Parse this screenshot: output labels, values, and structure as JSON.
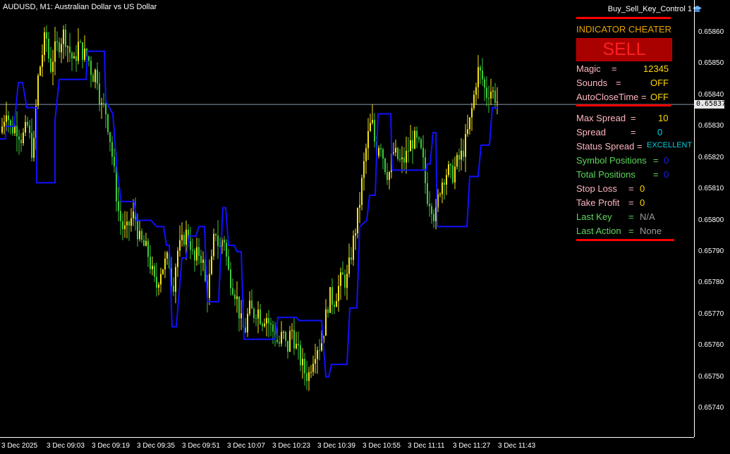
{
  "window": {
    "title": "AUDUSD, M1:  Australian Dollar vs US Dollar",
    "ea_name": "Buy_Sell_Key_Control 1",
    "current_price": "0.65837"
  },
  "axes": {
    "price_labels": [
      "0.65860",
      "0.65850",
      "0.65840",
      "0.65830",
      "0.65820",
      "0.65810",
      "0.65800",
      "0.65790",
      "0.65780",
      "0.65770",
      "0.65760",
      "0.65750",
      "0.65740"
    ],
    "time_labels": [
      "3 Dec 2025",
      "3 Dec 09:03",
      "3 Dec 09:19",
      "3 Dec 09:35",
      "3 Dec 09:51",
      "3 Dec 10:07",
      "3 Dec 10:23",
      "3 Dec 10:39",
      "3 Dec 10:55",
      "3 Dec 11:11",
      "3 Dec 11:27",
      "3 Dec 11:43"
    ]
  },
  "panel": {
    "title": "INDICATOR CHEATER",
    "signal": "SELL",
    "magic_label": "Magic",
    "magic_eq": "=",
    "magic_value": "12345",
    "sounds_label": "Sounds",
    "sounds_eq": "=",
    "sounds_value": "OFF",
    "autoclose_label": "AutoCloseTime =",
    "autoclose_value": "OFF",
    "max_spread_label": "Max Spread",
    "max_spread_eq": "=",
    "max_spread_value": "10",
    "spread_label": "Spread",
    "spread_eq": "=",
    "spread_value": "0",
    "status_spread_label": "Status Spread =",
    "status_spread_value": "EXCELLENT",
    "symbol_positions_label": "Symbol Positions",
    "symbol_positions_eq": "=",
    "symbol_positions_value": "0",
    "total_positions_label": "Total Positions",
    "total_positions_eq": "=",
    "total_positions_value": "0",
    "stop_loss_label": "Stop Loss",
    "stop_loss_eq": "=",
    "stop_loss_value": "0",
    "take_profit_label": "Take Profit",
    "take_profit_eq": "=",
    "take_profit_value": "0",
    "last_key_label": "Last Key",
    "last_key_eq": "=",
    "last_key_value": "N/A",
    "last_action_label": "Last Action",
    "last_action_eq": "=",
    "last_action_value": "None"
  },
  "colors": {
    "bull": "#f2e11a",
    "bear": "#3cc93c",
    "indicator": "#1010ff",
    "bid_line": "#8a9ab0",
    "title": "#e8a300",
    "label_pink": "#ffb6c1",
    "label_green": "#5cd65c",
    "value_yellow": "#ffd700",
    "value_cyan": "#00d0e0",
    "value_blue": "#1c1cff",
    "value_gray": "#9a9a9a"
  },
  "chart_data": {
    "type": "candlestick",
    "symbol": "AUDUSD",
    "timeframe": "M1",
    "ylim": [
      0.65734,
      0.65868
    ],
    "y_ticks": [
      0.6586,
      0.6585,
      0.6584,
      0.6583,
      0.6582,
      0.6581,
      0.658,
      0.6579,
      0.6578,
      0.6577,
      0.6576,
      0.6575,
      0.6574
    ],
    "bid": 0.65837,
    "x_ticks": [
      "3 Dec 2025",
      "3 Dec 09:03",
      "3 Dec 09:19",
      "3 Dec 09:35",
      "3 Dec 09:51",
      "3 Dec 10:07",
      "3 Dec 10:23",
      "3 Dec 10:39",
      "3 Dec 10:55",
      "3 Dec 11:11",
      "3 Dec 11:27",
      "3 Dec 11:43"
    ],
    "close_path": [
      [
        0,
        0.65828
      ],
      [
        8,
        0.65836
      ],
      [
        14,
        0.65829
      ],
      [
        22,
        0.6583
      ],
      [
        30,
        0.65826
      ],
      [
        38,
        0.6583
      ],
      [
        46,
        0.6582
      ],
      [
        52,
        0.65844
      ],
      [
        58,
        0.65852
      ],
      [
        64,
        0.6586
      ],
      [
        70,
        0.65848
      ],
      [
        76,
        0.65854
      ],
      [
        82,
        0.65856
      ],
      [
        90,
        0.6586
      ],
      [
        96,
        0.65855
      ],
      [
        104,
        0.6585
      ],
      [
        110,
        0.65856
      ],
      [
        118,
        0.65853
      ],
      [
        124,
        0.65852
      ],
      [
        130,
        0.65846
      ],
      [
        136,
        0.65848
      ],
      [
        142,
        0.65836
      ],
      [
        148,
        0.65836
      ],
      [
        154,
        0.65828
      ],
      [
        160,
        0.65817
      ],
      [
        166,
        0.65804
      ],
      [
        172,
        0.65798
      ],
      [
        178,
        0.65796
      ],
      [
        184,
        0.658
      ],
      [
        190,
        0.65802
      ],
      [
        196,
        0.65794
      ],
      [
        202,
        0.65792
      ],
      [
        208,
        0.6579
      ],
      [
        214,
        0.65784
      ],
      [
        220,
        0.65778
      ],
      [
        226,
        0.65784
      ],
      [
        232,
        0.65786
      ],
      [
        238,
        0.65788
      ],
      [
        244,
        0.65778
      ],
      [
        250,
        0.6579
      ],
      [
        256,
        0.65792
      ],
      [
        262,
        0.65796
      ],
      [
        268,
        0.65794
      ],
      [
        274,
        0.65786
      ],
      [
        280,
        0.6579
      ],
      [
        286,
        0.65788
      ],
      [
        292,
        0.65776
      ],
      [
        298,
        0.65784
      ],
      [
        304,
        0.65798
      ],
      [
        310,
        0.6579
      ],
      [
        316,
        0.65796
      ],
      [
        322,
        0.65784
      ],
      [
        328,
        0.6578
      ],
      [
        334,
        0.65776
      ],
      [
        340,
        0.65768
      ],
      [
        346,
        0.65764
      ],
      [
        352,
        0.65772
      ],
      [
        358,
        0.6577
      ],
      [
        364,
        0.65772
      ],
      [
        370,
        0.65768
      ],
      [
        376,
        0.6577
      ],
      [
        382,
        0.65766
      ],
      [
        388,
        0.65764
      ],
      [
        394,
        0.6576
      ],
      [
        400,
        0.65764
      ],
      [
        406,
        0.65758
      ],
      [
        412,
        0.65766
      ],
      [
        418,
        0.6576
      ],
      [
        424,
        0.65756
      ],
      [
        430,
        0.65752
      ],
      [
        436,
        0.6575
      ],
      [
        442,
        0.65756
      ],
      [
        448,
        0.6576
      ],
      [
        454,
        0.6576
      ],
      [
        460,
        0.65768
      ],
      [
        466,
        0.65776
      ],
      [
        472,
        0.65774
      ],
      [
        478,
        0.65778
      ],
      [
        484,
        0.65782
      ],
      [
        490,
        0.6578
      ],
      [
        496,
        0.65788
      ],
      [
        502,
        0.65796
      ],
      [
        508,
        0.65804
      ],
      [
        514,
        0.65816
      ],
      [
        520,
        0.65826
      ],
      [
        526,
        0.65832
      ],
      [
        532,
        0.65822
      ],
      [
        538,
        0.65826
      ],
      [
        544,
        0.65818
      ],
      [
        550,
        0.65814
      ],
      [
        556,
        0.65822
      ],
      [
        562,
        0.6582
      ],
      [
        568,
        0.65818
      ],
      [
        574,
        0.6582
      ],
      [
        580,
        0.65824
      ],
      [
        586,
        0.65826
      ],
      [
        592,
        0.65824
      ],
      [
        598,
        0.6582
      ],
      [
        604,
        0.65808
      ],
      [
        610,
        0.65806
      ],
      [
        616,
        0.658
      ],
      [
        622,
        0.6581
      ],
      [
        628,
        0.65814
      ],
      [
        634,
        0.65816
      ],
      [
        640,
        0.65814
      ],
      [
        646,
        0.65818
      ],
      [
        652,
        0.6582
      ],
      [
        658,
        0.65824
      ],
      [
        664,
        0.6583
      ],
      [
        670,
        0.65838
      ],
      [
        676,
        0.65848
      ],
      [
        682,
        0.65846
      ],
      [
        688,
        0.6584
      ],
      [
        694,
        0.65842
      ],
      [
        700,
        0.6584
      ],
      [
        706,
        0.65837
      ]
    ],
    "indicator_line": [
      [
        0,
        0.65826
      ],
      [
        8,
        0.65826
      ],
      [
        8,
        0.6583
      ],
      [
        20,
        0.6583
      ],
      [
        26,
        0.65844
      ],
      [
        32,
        0.65844
      ],
      [
        38,
        0.65836
      ],
      [
        52,
        0.65836
      ],
      [
        52,
        0.65812
      ],
      [
        78,
        0.65812
      ],
      [
        78,
        0.65832
      ],
      [
        84,
        0.65845
      ],
      [
        122,
        0.65845
      ],
      [
        124,
        0.65854
      ],
      [
        148,
        0.65854
      ],
      [
        150,
        0.65838
      ],
      [
        160,
        0.65834
      ],
      [
        166,
        0.65816
      ],
      [
        172,
        0.65806
      ],
      [
        190,
        0.65806
      ],
      [
        194,
        0.658
      ],
      [
        214,
        0.658
      ],
      [
        222,
        0.65798
      ],
      [
        232,
        0.65798
      ],
      [
        236,
        0.65792
      ],
      [
        240,
        0.65792
      ],
      [
        244,
        0.65766
      ],
      [
        250,
        0.65766
      ],
      [
        258,
        0.65788
      ],
      [
        264,
        0.65788
      ],
      [
        268,
        0.65795
      ],
      [
        278,
        0.65795
      ],
      [
        282,
        0.65798
      ],
      [
        290,
        0.65798
      ],
      [
        294,
        0.65774
      ],
      [
        310,
        0.65774
      ],
      [
        316,
        0.65804
      ],
      [
        320,
        0.65804
      ],
      [
        324,
        0.65792
      ],
      [
        332,
        0.65792
      ],
      [
        336,
        0.6579
      ],
      [
        342,
        0.6579
      ],
      [
        346,
        0.65762
      ],
      [
        390,
        0.65762
      ],
      [
        394,
        0.65769
      ],
      [
        420,
        0.65769
      ],
      [
        424,
        0.65768
      ],
      [
        456,
        0.65768
      ],
      [
        462,
        0.6575
      ],
      [
        466,
        0.6575
      ],
      [
        470,
        0.65754
      ],
      [
        492,
        0.65754
      ],
      [
        496,
        0.65772
      ],
      [
        506,
        0.65772
      ],
      [
        510,
        0.65798
      ],
      [
        520,
        0.658
      ],
      [
        524,
        0.65808
      ],
      [
        532,
        0.65808
      ],
      [
        536,
        0.65834
      ],
      [
        554,
        0.65834
      ],
      [
        556,
        0.65816
      ],
      [
        604,
        0.65816
      ],
      [
        606,
        0.65818
      ],
      [
        610,
        0.65818
      ],
      [
        614,
        0.65828
      ],
      [
        618,
        0.65828
      ],
      [
        620,
        0.65798
      ],
      [
        662,
        0.65798
      ],
      [
        666,
        0.65814
      ],
      [
        678,
        0.65814
      ],
      [
        682,
        0.65824
      ],
      [
        694,
        0.65824
      ],
      [
        698,
        0.65836
      ],
      [
        706,
        0.65836
      ]
    ]
  }
}
